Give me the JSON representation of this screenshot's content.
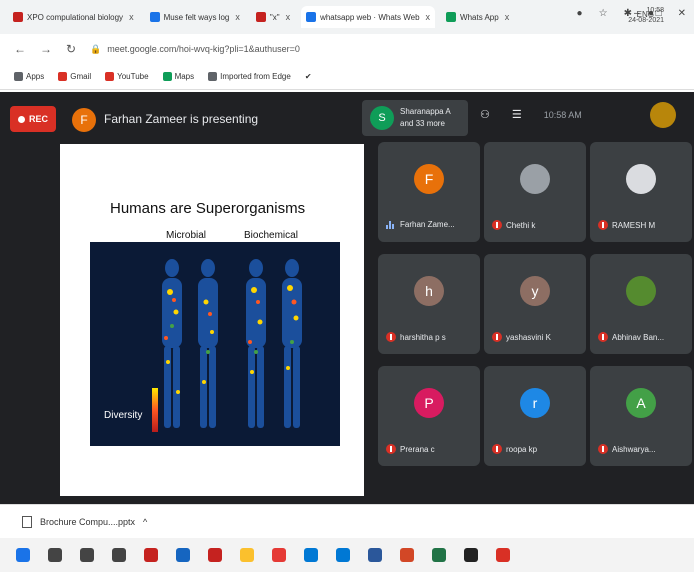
{
  "browser": {
    "tabs": [
      {
        "label": "XPO compulational biology",
        "color": "#c5221f",
        "active": false
      },
      {
        "label": "Muse felt ways log",
        "color": "#1a73e8",
        "active": false
      },
      {
        "label": "\"x\"",
        "color": "#c5221f",
        "active": false
      },
      {
        "label": "whatsapp web · Whats Web",
        "color": "#1a73e8",
        "active": true
      },
      {
        "label": "Whats App",
        "color": "#0f9d58",
        "active": false
      }
    ],
    "tab_close": "x",
    "url": "meet.google.com/hoi-wvq-kig?pli=1&authuser=0",
    "bookmarks": [
      {
        "label": "Apps",
        "color": "#5f6368"
      },
      {
        "label": "Gmail",
        "color": "#d93025"
      },
      {
        "label": "YouTube",
        "color": "#d93025"
      },
      {
        "label": "Maps",
        "color": "#0f9d58"
      },
      {
        "label": "Imported from Edge",
        "color": "#5f6368"
      }
    ]
  },
  "meet": {
    "rec_label": "REC",
    "presenter_initial": "F",
    "presenting_text": "Farhan Zameer is presenting",
    "count_initial": "S",
    "count_line1": "Sharanappa A",
    "count_line2": "and 33 more",
    "clock": "10:58 AM",
    "slide": {
      "title": "Humans are Superorganisms",
      "label_left": "Microbial",
      "label_right": "Biochemical",
      "diversity": "Diversity"
    },
    "participants": [
      {
        "initial": "F",
        "name": "Farhan Zame...",
        "color": "#e8710a",
        "muted": false
      },
      {
        "initial": "",
        "name": "Chethi k",
        "color": "#9aa0a6",
        "muted": true
      },
      {
        "initial": "",
        "name": "RAMESH M",
        "color": "#dadce0",
        "muted": true
      },
      {
        "initial": "h",
        "name": "harshitha p s",
        "color": "#8d6e63",
        "muted": true
      },
      {
        "initial": "y",
        "name": "yashasvini K",
        "color": "#8d6e63",
        "muted": true
      },
      {
        "initial": "",
        "name": "Abhinav Ban...",
        "color": "#558b2f",
        "muted": true
      },
      {
        "initial": "P",
        "name": "Prerana c",
        "color": "#d81b60",
        "muted": true
      },
      {
        "initial": "r",
        "name": "roopa kp",
        "color": "#1e88e5",
        "muted": true
      },
      {
        "initial": "A",
        "name": "Aishwarya...",
        "color": "#43a047",
        "muted": true
      }
    ]
  },
  "download": {
    "file": "Brochure Compu....pptx",
    "chevron": "^"
  },
  "taskbar": {
    "apps": [
      "#1a73e8",
      "#444444",
      "#444444",
      "#444444",
      "#c5221f",
      "#1565c0",
      "#c5221f",
      "#fbc02d",
      "#e53935",
      "#0078d4",
      "#0078d4",
      "#2b579a",
      "#d24726",
      "#217346",
      "#222222",
      "#d93025"
    ],
    "tray": "ENG",
    "time": "10:58",
    "date": "24-08-2021"
  }
}
